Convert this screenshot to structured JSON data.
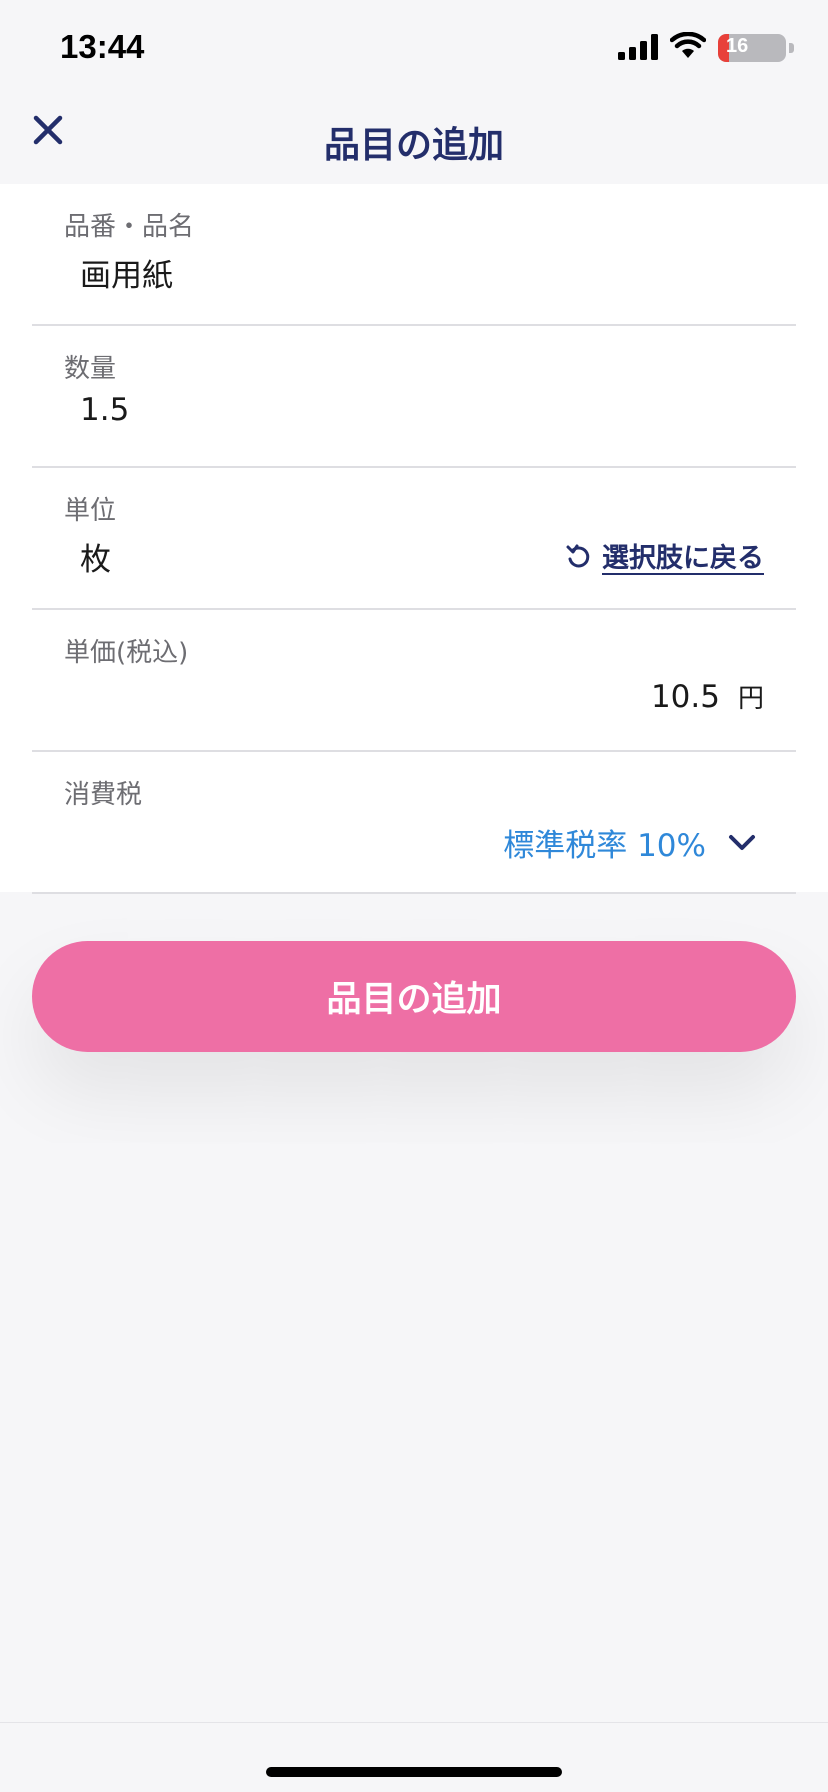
{
  "status_bar": {
    "time": "13:44",
    "battery_level": "16",
    "battery_color": "#e8403a",
    "icons": [
      "signal-icon",
      "wifi-icon",
      "battery-icon"
    ]
  },
  "header": {
    "title": "品目の追加",
    "close_icon": "close-icon"
  },
  "form": {
    "item_name": {
      "label": "品番・品名",
      "value": "画用紙"
    },
    "quantity": {
      "label": "数量",
      "value": "1.5"
    },
    "unit": {
      "label": "単位",
      "value": "枚",
      "revert_label": "選択肢に戻る",
      "revert_icon": "revert-icon"
    },
    "unit_price": {
      "label": "単価(税込)",
      "value": "10.5",
      "currency": "円"
    },
    "tax": {
      "label": "消費税",
      "selected": "標準税率 10%",
      "icon": "chevron-down-icon"
    }
  },
  "submit": {
    "label": "品目の追加"
  },
  "colors": {
    "primary_navy": "#232e6b",
    "accent_pink": "#ee6fa5",
    "link_blue": "#2f88d9"
  }
}
